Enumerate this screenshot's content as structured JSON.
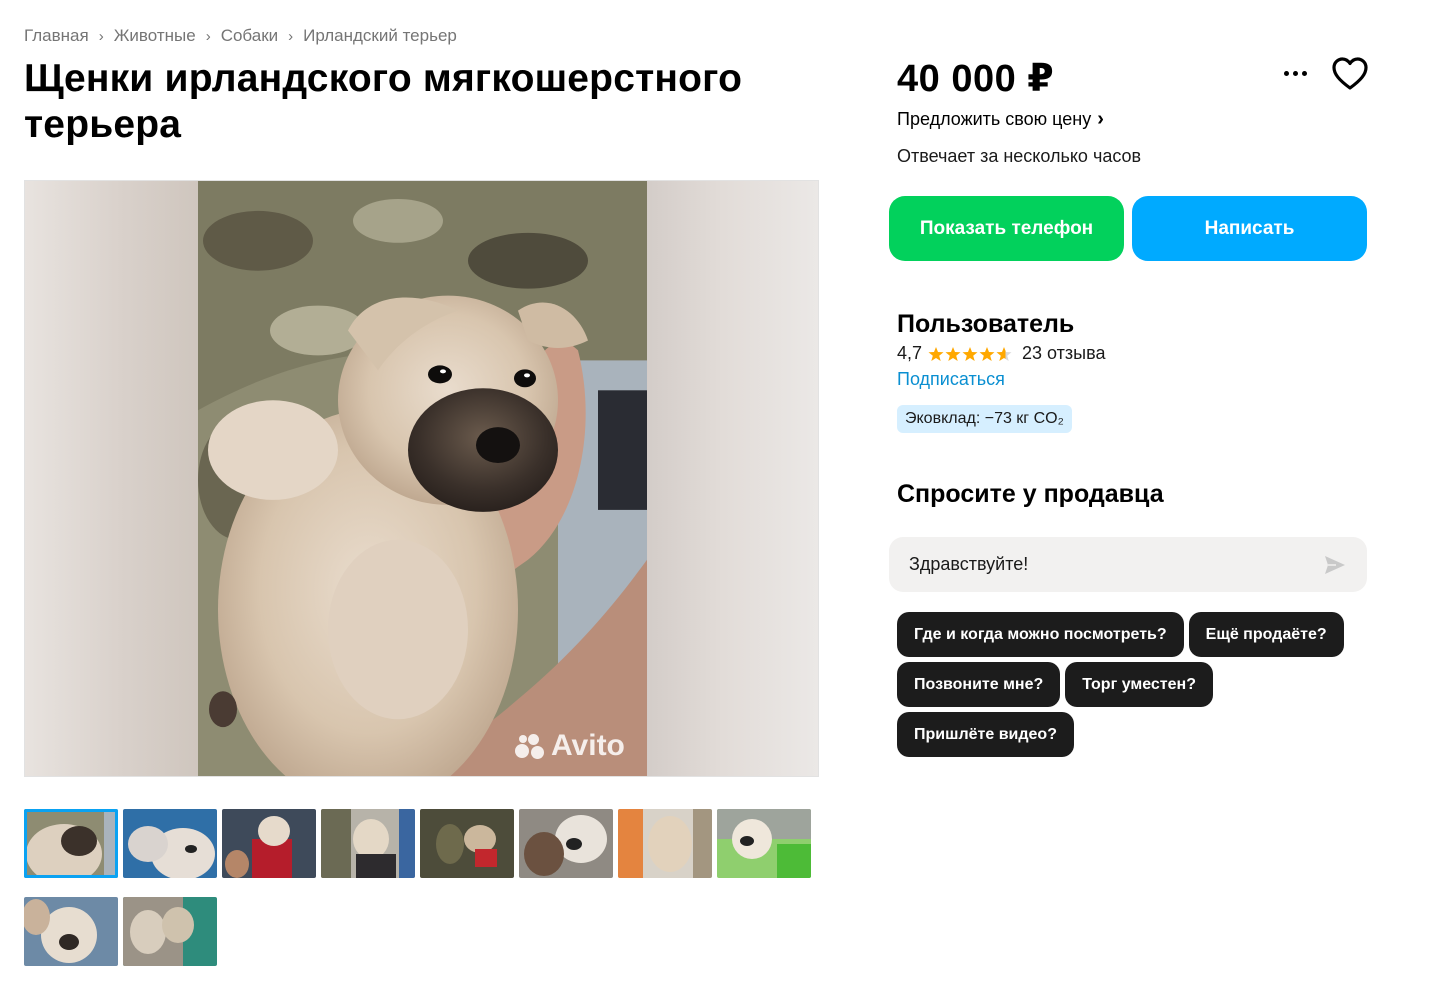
{
  "breadcrumbs": [
    "Главная",
    "Животные",
    "Собаки",
    "Ирландский терьер"
  ],
  "title": "Щенки ирландского мягкошерстного терьера",
  "gallery": {
    "watermark": "Avito",
    "thumbnails": [
      {
        "label": "photo-1",
        "active": true
      },
      {
        "label": "photo-2"
      },
      {
        "label": "photo-3"
      },
      {
        "label": "photo-4"
      },
      {
        "label": "photo-5"
      },
      {
        "label": "photo-6"
      },
      {
        "label": "photo-7"
      },
      {
        "label": "photo-8"
      },
      {
        "label": "photo-9"
      },
      {
        "label": "photo-10"
      }
    ]
  },
  "price": "40 000 ₽",
  "offer_price_label": "Предложить свою цену",
  "response_time": "Отвечает за несколько часов",
  "buttons": {
    "show_phone": "Показать телефон",
    "write": "Написать"
  },
  "seller": {
    "name": "Пользователь",
    "rating": "4,7",
    "rating_value": 4.7,
    "reviews": "23 отзыва",
    "subscribe": "Подписаться",
    "eco": "Эковклад: −73 кг CO₂"
  },
  "ask": {
    "title": "Спросите у продавца",
    "input_value": "Здравствуйте!",
    "chips": [
      "Где и когда можно посмотреть?",
      "Ещё продаёте?",
      "Позвоните мне?",
      "Торг уместен?",
      "Пришлёте видео?"
    ]
  },
  "colors": {
    "accent_green": "#02d15c",
    "accent_blue": "#00aaff",
    "link_blue": "#0a8fd1",
    "star": "#ffa800",
    "chip_bg": "#1c1c1c"
  }
}
